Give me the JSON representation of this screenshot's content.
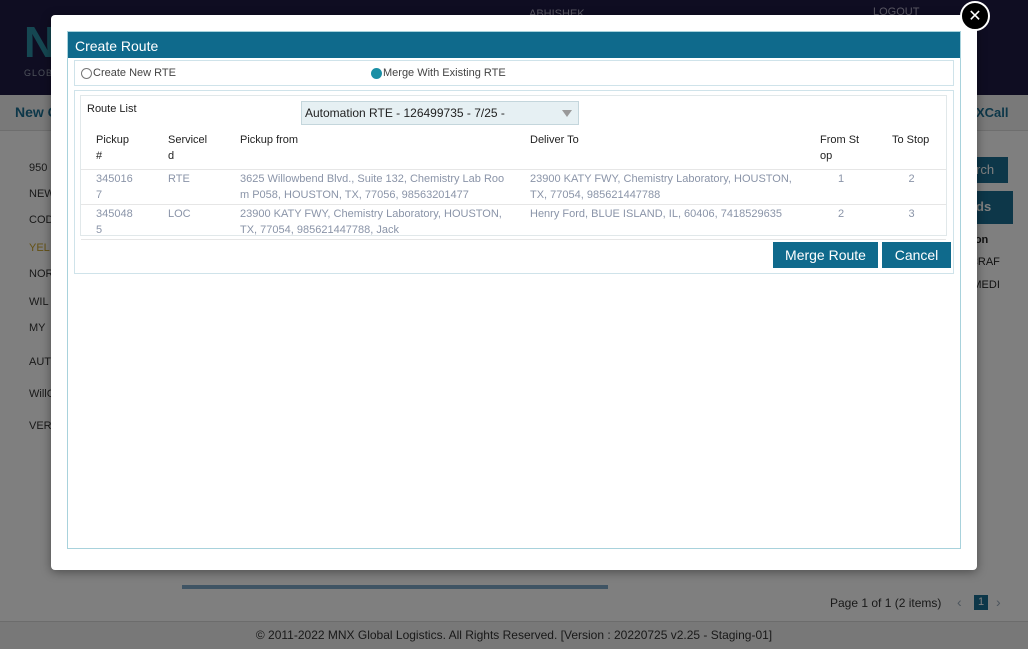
{
  "background": {
    "logo_text": "GLOBAL",
    "user": "ABHISHEK",
    "logout": "LOGOUT",
    "page_title": "New C",
    "call_label": "XCall",
    "side_items": [
      "950",
      "NEW",
      "COD",
      "YEL",
      "NOR",
      "WIL",
      "MY",
      "AUTO",
      "WillC",
      "VERI"
    ],
    "search_btn": "rch",
    "leads_btn": "ds",
    "col_header": "ation",
    "col_rows": [
      "RCRAF",
      "S MEDI"
    ],
    "pager_text": "Page 1 of 1 (2 items)",
    "prev": "‹",
    "page_num": "1",
    "next": "›",
    "footer": "© 2011-2022 MNX Global Logistics. All Rights Reserved. [Version : 20220725 v2.25 - Staging-01]"
  },
  "modal": {
    "close_symbol": "✕",
    "title": "Create Route",
    "radio_create": "Create New RTE",
    "radio_merge": "Merge With Existing RTE",
    "route_list_label": "Route List",
    "route_selected": "Automation RTE - 126499735 - 7/25 -",
    "columns": [
      "Pickup\n#",
      "Servicel\nd",
      "Pickup from",
      "Deliver To",
      "From St\nop",
      "To Stop"
    ],
    "rows": [
      {
        "pickup": "345016\n7",
        "service": "RTE",
        "pickup_from": "3625 Willowbend Blvd., Suite 132, Chemistry Lab Roo\nm P058, HOUSTON, TX, 77056, 98563201477",
        "deliver_to": "23900 KATY FWY, Chemistry Laboratory, HOUSTON,\nTX, 77054, 985621447788",
        "from_stop": "1",
        "to_stop": "2"
      },
      {
        "pickup": "345048\n5",
        "service": "LOC",
        "pickup_from": "23900 KATY FWY, Chemistry Laboratory, HOUSTON,\nTX, 77054, 985621447788, Jack",
        "deliver_to": "Henry Ford, BLUE ISLAND, IL, 60406, 7418529635",
        "from_stop": "2",
        "to_stop": "3"
      }
    ],
    "merge_button": "Merge Route",
    "cancel_button": "Cancel"
  }
}
